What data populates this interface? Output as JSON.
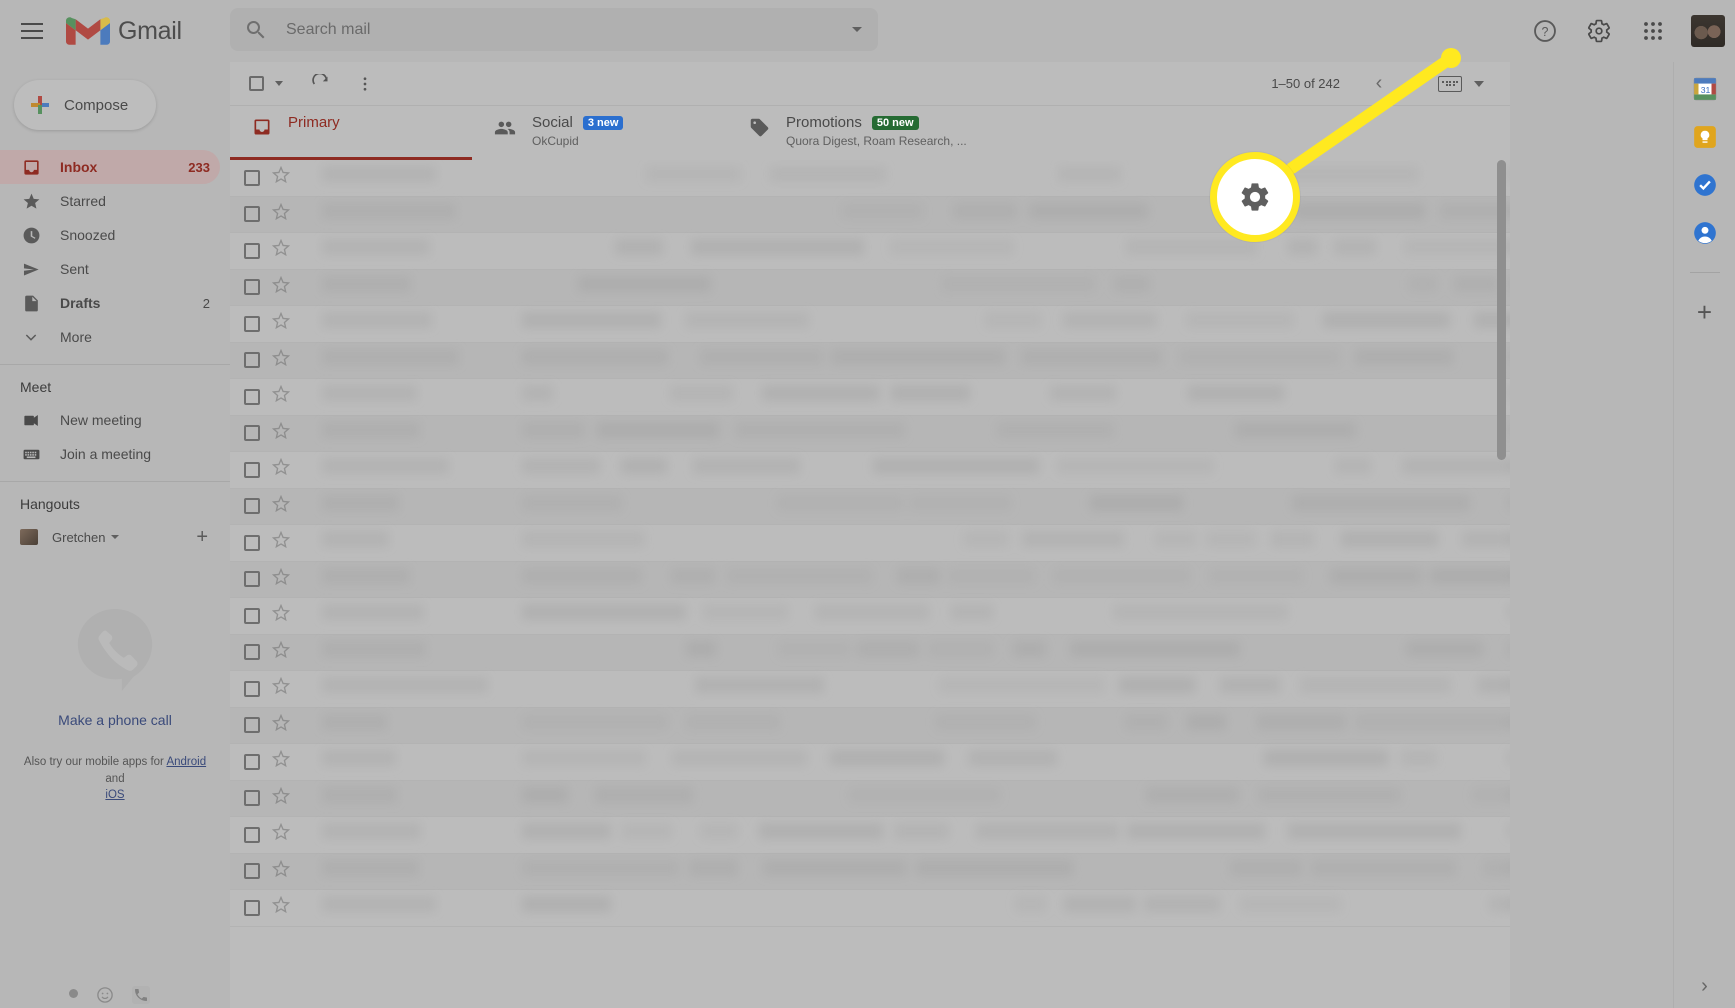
{
  "app": {
    "brand": "Gmail",
    "menu_icon": "hamburger-icon"
  },
  "search": {
    "placeholder": "Search mail",
    "value": "",
    "icon": "search-icon",
    "options_icon": "chevron-down-icon"
  },
  "header_actions": {
    "support": "support-icon",
    "settings": "gear-icon",
    "apps": "google-apps-grid-icon",
    "account": "account-avatar"
  },
  "compose": {
    "label": "Compose",
    "icon": "plus-icon"
  },
  "sidebar": {
    "items": [
      {
        "label": "Inbox",
        "count": "233",
        "icon": "inbox-icon",
        "active": true
      },
      {
        "label": "Starred",
        "count": "",
        "icon": "star-icon",
        "active": false
      },
      {
        "label": "Snoozed",
        "count": "",
        "icon": "clock-icon",
        "active": false
      },
      {
        "label": "Sent",
        "count": "",
        "icon": "send-icon",
        "active": false
      },
      {
        "label": "Drafts",
        "count": "2",
        "icon": "draft-icon",
        "active": false
      },
      {
        "label": "More",
        "count": "",
        "icon": "chevron-down-icon",
        "active": false
      }
    ],
    "meet": {
      "heading": "Meet",
      "items": [
        {
          "label": "New meeting",
          "icon": "video-camera-icon"
        },
        {
          "label": "Join a meeting",
          "icon": "keyboard-icon"
        }
      ]
    },
    "hangouts": {
      "heading": "Hangouts",
      "user": "Gretchen",
      "add_icon": "plus-icon",
      "caret_icon": "chevron-down-icon"
    },
    "promo": {
      "phone_icon": "google-voice-phone-icon",
      "call_link": "Make a phone call",
      "text_before": "Also try our mobile apps for",
      "android_link": "Android",
      "text_middle": "and",
      "ios_link": "iOS"
    },
    "status_icons": [
      "presence-dot-icon",
      "mood-icon",
      "phone-icon"
    ]
  },
  "toolbar": {
    "select_all_icon": "checkbox-icon",
    "select_caret_icon": "chevron-down-icon",
    "refresh_icon": "refresh-icon",
    "more_icon": "more-vertical-icon",
    "pagination": "1–50 of 242",
    "prev_icon": "chevron-left-icon",
    "next_icon": "chevron-right-icon",
    "input_tools_icon": "keyboard-icon",
    "input_tools_caret_icon": "chevron-down-icon"
  },
  "tabs": [
    {
      "label": "Primary",
      "icon": "inbox-tab-icon",
      "badge": "",
      "badge_color": "",
      "sub": "",
      "active": true
    },
    {
      "label": "Social",
      "icon": "people-tab-icon",
      "badge": "3 new",
      "badge_color": "#2b6fcf",
      "sub": "OkCupid",
      "active": false
    },
    {
      "label": "Promotions",
      "icon": "tag-tab-icon",
      "badge": "50 new",
      "badge_color": "#256b33",
      "sub": "Quora Digest, Roam Research, ...",
      "active": false
    }
  ],
  "side_panel": {
    "items": [
      {
        "name": "google-calendar-icon",
        "label": "31"
      },
      {
        "name": "google-keep-icon",
        "label": ""
      },
      {
        "name": "google-tasks-icon",
        "label": ""
      },
      {
        "name": "google-contacts-icon",
        "label": ""
      }
    ],
    "add_label": "+",
    "expand_icon": "chevron-right-icon"
  },
  "callout": {
    "target": "gear-icon",
    "highlight_color": "#ffe920"
  },
  "message_list": {
    "row_count": 21,
    "rows_blurred": true
  }
}
